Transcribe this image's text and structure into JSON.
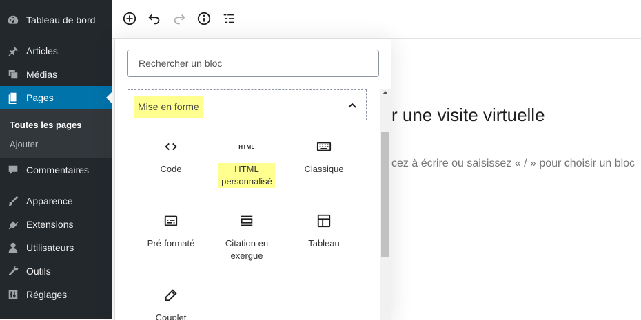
{
  "sidebar": {
    "items": [
      {
        "label": "Tableau de bord",
        "icon": "dashboard-icon"
      },
      {
        "label": "Articles",
        "icon": "pin-icon"
      },
      {
        "label": "Médias",
        "icon": "media-icon"
      },
      {
        "label": "Pages",
        "icon": "pages-icon"
      },
      {
        "label": "Commentaires",
        "icon": "comment-icon"
      },
      {
        "label": "Apparence",
        "icon": "brush-icon"
      },
      {
        "label": "Extensions",
        "icon": "plugin-icon"
      },
      {
        "label": "Utilisateurs",
        "icon": "user-icon"
      },
      {
        "label": "Outils",
        "icon": "wrench-icon"
      },
      {
        "label": "Réglages",
        "icon": "settings-icon"
      }
    ],
    "submenu": {
      "all_pages": "Toutes les pages",
      "add": "Ajouter"
    }
  },
  "toolbar": {
    "buttons": [
      "add-block-icon",
      "undo-icon",
      "redo-icon",
      "info-icon",
      "list-view-icon"
    ]
  },
  "inserter": {
    "search_placeholder": "Rechercher un bloc",
    "panel_title": "Mise en forme",
    "blocks": [
      {
        "label": "Code",
        "icon": "code-icon"
      },
      {
        "label_line1": "HTML",
        "label_line2": "personnalisé",
        "icon": "html-icon",
        "icon_text": "HTML"
      },
      {
        "label": "Classique",
        "icon": "keyboard-icon"
      },
      {
        "label": "Pré-formaté",
        "icon": "preformatted-icon"
      },
      {
        "label_line1": "Citation en",
        "label_line2": "exergue",
        "icon": "pullquote-icon"
      },
      {
        "label": "Tableau",
        "icon": "table-icon"
      },
      {
        "label": "Couplet",
        "icon": "pencil-icon"
      }
    ]
  },
  "editor": {
    "title_fragment": "r une visite virtuelle",
    "hint_fragment": "cez à écrire ou saisissez « / » pour choisir un bloc"
  },
  "colors": {
    "sidebar_bg": "#23282d",
    "active_bg": "#0073aa",
    "highlight": "#ffff90"
  }
}
